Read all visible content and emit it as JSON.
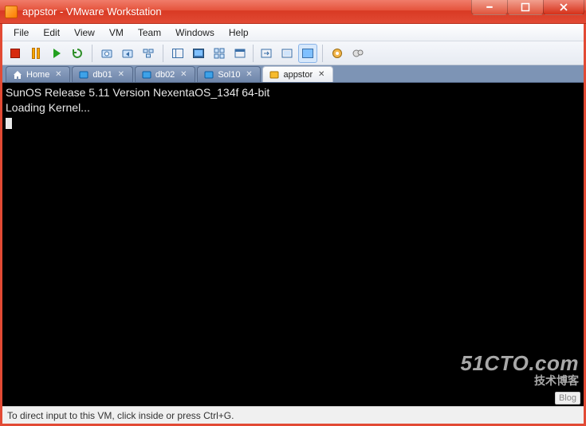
{
  "window": {
    "title": "appstor - VMware Workstation"
  },
  "menu": {
    "items": [
      "File",
      "Edit",
      "View",
      "VM",
      "Team",
      "Windows",
      "Help"
    ]
  },
  "tabs": {
    "home": "Home",
    "items": [
      {
        "label": "db01"
      },
      {
        "label": "db02"
      },
      {
        "label": "Sol10"
      },
      {
        "label": "appstor",
        "active": true
      }
    ]
  },
  "terminal": {
    "lines": [
      "SunOS Release 5.11 Version NexentaOS_134f 64-bit",
      "Loading Kernel..."
    ]
  },
  "status": {
    "text": "To direct input to this VM, click inside or press Ctrl+G."
  },
  "watermark": {
    "line1": "51CTO.com",
    "line2": "技术博客",
    "badge": "Blog"
  }
}
